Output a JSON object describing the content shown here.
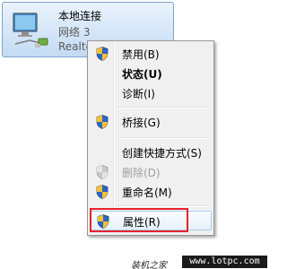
{
  "adapter": {
    "name": "本地连接",
    "network": "网络  3",
    "device": "Realtek PCIe GBE Family Controller",
    "icon": "network-adapter-icon"
  },
  "context_menu": {
    "items": [
      {
        "label": "禁用(B)",
        "icon": "shield-icon",
        "bold": false,
        "disabled": false
      },
      {
        "label": "状态(U)",
        "icon": "",
        "bold": true,
        "disabled": false
      },
      {
        "label": "诊断(I)",
        "icon": "",
        "bold": false,
        "disabled": false
      },
      {
        "label": "桥接(G)",
        "icon": "shield-icon",
        "bold": false,
        "disabled": false
      },
      {
        "label": "创建快捷方式(S)",
        "icon": "",
        "bold": false,
        "disabled": false
      },
      {
        "label": "删除(D)",
        "icon": "shield-icon",
        "bold": false,
        "disabled": true
      },
      {
        "label": "重命名(M)",
        "icon": "shield-icon",
        "bold": false,
        "disabled": false
      },
      {
        "label": "属性(R)",
        "icon": "shield-icon",
        "bold": false,
        "disabled": false,
        "highlighted": true
      }
    ]
  },
  "watermark": {
    "site_name": "装机之家",
    "url": "www.lotpc.com"
  },
  "colors": {
    "highlight_box": "#e8232b",
    "selection_blue": "#c4dbf3",
    "shield_blue": "#2f66c7",
    "shield_yellow": "#f2c230"
  }
}
